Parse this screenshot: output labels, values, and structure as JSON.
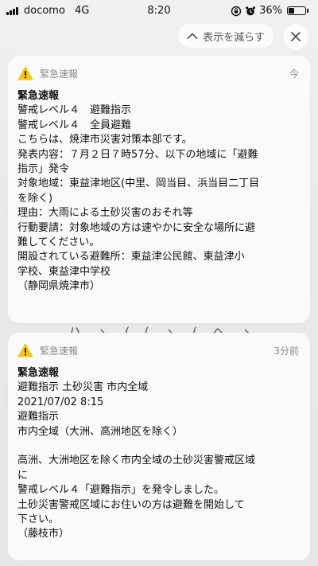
{
  "status_bar": {
    "carrier": "docomo",
    "network": "4G",
    "time": "8:20",
    "battery_percent": "36%",
    "battery_level": 0.36,
    "icons": [
      "signal-bars-icon",
      "orientation-lock-icon",
      "alarm-icon",
      "battery-icon"
    ]
  },
  "controls": {
    "show_less_label": "表示を減らす",
    "show_less_icon": "chevron-up-icon",
    "close_icon": "close-icon"
  },
  "colors": {
    "warning_yellow": "#f5c518",
    "secondary_text": "#8a8a8a",
    "card_background": "#fafafa"
  },
  "notifications": [
    {
      "app": "緊急速報",
      "icon": "warning-icon",
      "time": "今",
      "title": "緊急速報",
      "lines": [
        "警戒レベル４　避難指示",
        "警戒レベル４　全員避難",
        "こちらは、焼津市災害対策本部です。",
        "発表内容：７月２日７時57分、以下の地域に「避難",
        "指示」発令",
        "対象地域：東益津地区(中里、岡当目、浜当目二丁目",
        "を除く)",
        "理由：大雨による土砂災害のおそれ等",
        "行動要請：対象地域の方は速やかに安全な場所に避",
        "難してください。",
        "開設されている避難所：東益津公民館、東益津小",
        "学校、東益津中学校",
        "（静岡県焼津市）"
      ]
    },
    {
      "app": "緊急速報",
      "icon": "warning-icon",
      "time": "3分前",
      "title": "緊急速報",
      "lines": [
        "避難指示 土砂災害 市内全域",
        "2021/07/02 8:15",
        "避難指示",
        "市内全域（大洲、高洲地区を除く）",
        " ",
        "高洲、大洲地区を除く市内全域の土砂災害警戒区域",
        "に",
        "警戒レベル４「避難指示」を発令しました。",
        "土砂災害警戒区域にお住いの方は避難を開始して",
        "下さい。",
        "（藤枝市）"
      ]
    }
  ]
}
